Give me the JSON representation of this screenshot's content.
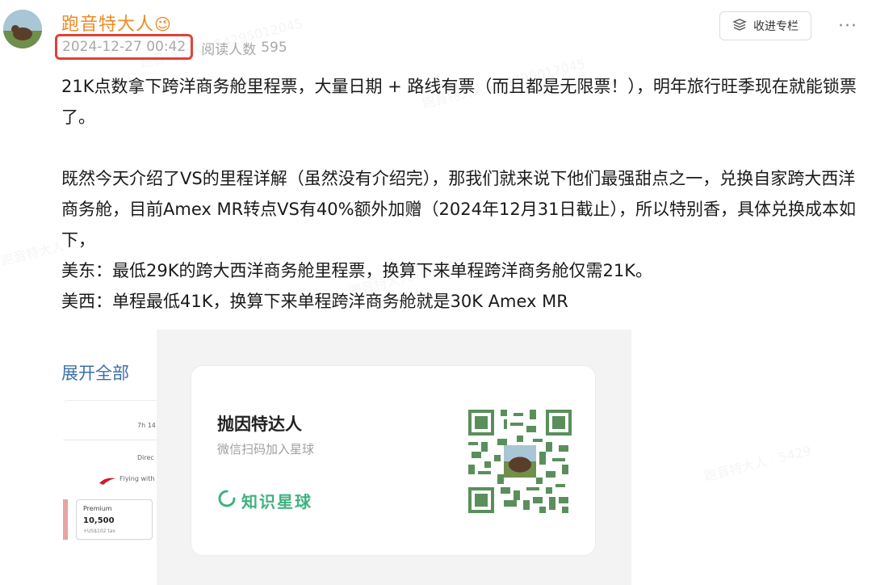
{
  "author": {
    "name": "跑音特大人",
    "emoji": "😉"
  },
  "post_meta": {
    "timestamp": "2024-12-27 00:42",
    "reads_label": "阅读人数",
    "reads_count": "595"
  },
  "actions": {
    "collect_label": "收进专栏",
    "more_label": "···"
  },
  "content": {
    "paragraphs": [
      "21K点数拿下跨洋商务舱里程票，大量日期 + 路线有票（而且都是无限票！），明年旅行旺季现在就能锁票了。",
      "",
      "既然今天介绍了VS的里程详解（虽然没有介绍完），那我们就来说下他们最强甜点之一，兑换自家跨大西洋商务舱，目前Amex MR转点VS有40%额外加赠（2024年12月31日截止），所以特别香，具体兑换成本如下，",
      "美东：最低29K的跨大西洋商务舱里程票，换算下来单程跨洋商务舱仅需21K。",
      "美西：单程最低41K，换算下来单程跨洋商务舱就是30K Amex MR"
    ],
    "expand_label": "展开全部"
  },
  "preview_card": {
    "line1": "7h 14",
    "line2": "Direc",
    "line3": "Flying with",
    "cabin": "Premium",
    "points": "10,500",
    "tax": "+US$102 tax"
  },
  "promo_card": {
    "title": "抛因特达人",
    "subtitle": "微信扫码加入星球",
    "brand": "知识星球"
  },
  "colors": {
    "username": "#f08a24",
    "highlight_box": "#e0413a",
    "link": "#3c6fa6",
    "brand_green": "#3fb27f",
    "qr_green": "#5a8f5c"
  }
}
